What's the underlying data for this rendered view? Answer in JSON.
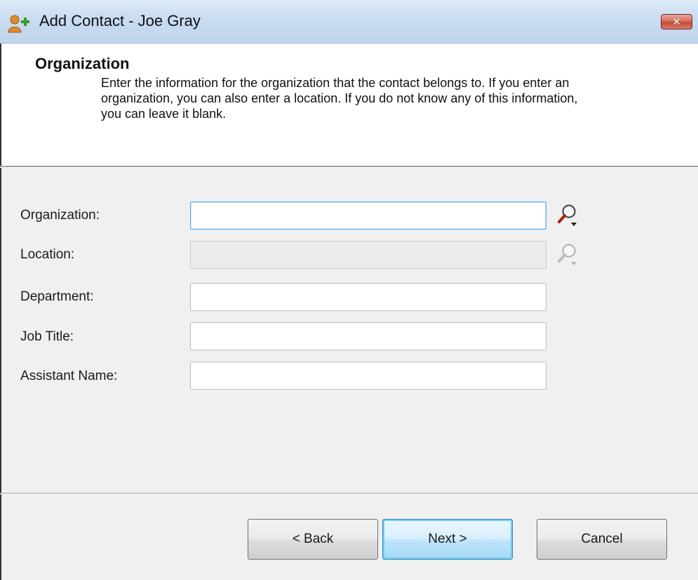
{
  "window": {
    "title": "Add Contact - Joe Gray",
    "close_glyph": "✕",
    "app_icon": "add-contact-icon"
  },
  "header": {
    "title": "Organization",
    "description": "Enter the information for the organization that the contact belongs to.  If you enter an\norganization, you can also enter a location.  If you do not know any of this information,\nyou can leave it blank."
  },
  "form": {
    "fields": [
      {
        "label": "Organization:",
        "value": "",
        "state": "focused",
        "lookup_icon": "magnifier-dropdown-icon"
      },
      {
        "label": "Location:",
        "value": "",
        "state": "disabled",
        "lookup_icon": "magnifier-dropdown-icon"
      },
      {
        "label": "Department:",
        "value": "",
        "state": "normal"
      },
      {
        "label": "Job Title:",
        "value": "",
        "state": "normal"
      },
      {
        "label": "Assistant Name:",
        "value": "",
        "state": "normal"
      }
    ]
  },
  "buttons": {
    "back": "< Back",
    "next": "Next >",
    "cancel": "Cancel"
  },
  "colors": {
    "title_bar": "#c9dcf0",
    "close_button": "#c24a36",
    "focus_border": "#5aa7e6",
    "default_button": "#bee6fd",
    "dialog_background": "#f0f0f0"
  }
}
